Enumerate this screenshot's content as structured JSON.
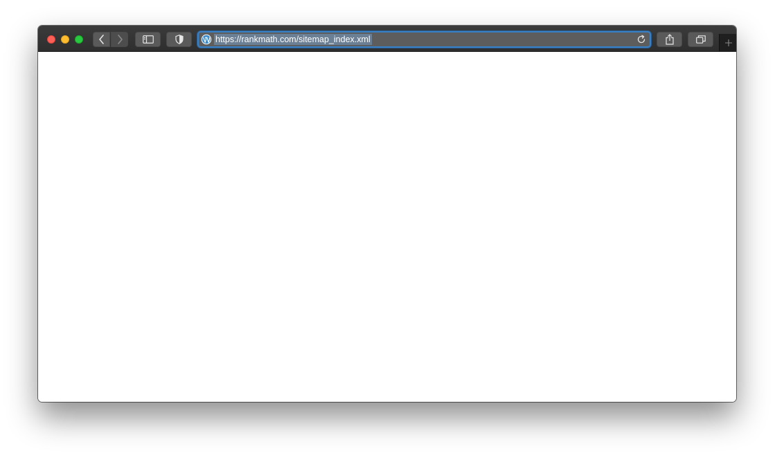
{
  "window": {
    "traffic_lights": [
      "close",
      "minimize",
      "maximize"
    ]
  },
  "toolbar": {
    "back_icon": "chevron-left-icon",
    "forward_icon": "chevron-right-icon",
    "sidebar_icon": "sidebar-icon",
    "shield_icon": "shield-icon",
    "share_icon": "share-icon",
    "tabs_icon": "tabs-overview-icon",
    "new_tab_icon": "plus-icon"
  },
  "address_bar": {
    "site_icon": "wordpress-icon",
    "url": "https://rankmath.com/sitemap_index.xml",
    "reload_icon": "reload-icon",
    "focus_color": "#3a7fc1"
  },
  "colors": {
    "close": "#fe5f57",
    "minimize": "#febc2e",
    "maximize": "#28c840",
    "toolbar": "#333333",
    "content": "#ffffff"
  }
}
